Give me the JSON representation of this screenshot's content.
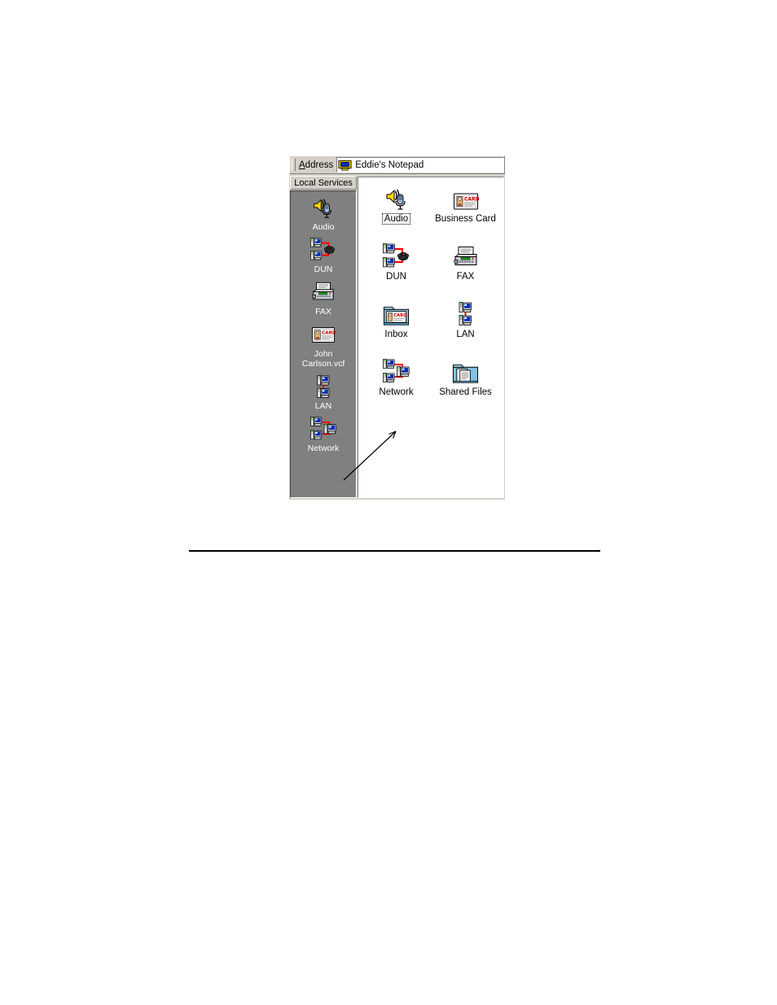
{
  "window": {
    "address_bar": {
      "label_prefix": "A",
      "label_rest": "ddress",
      "label_full": "Address",
      "icon": "notepad-device-icon",
      "value": "Eddie's Notepad",
      "placeholder": "Address"
    },
    "sidebar": {
      "header": "Local Services",
      "items": [
        {
          "label": "Audio",
          "icon": "audio-speaker-mic-icon"
        },
        {
          "label": "DUN",
          "icon": "dialup-networking-icon"
        },
        {
          "label": "FAX",
          "icon": "fax-machine-icon"
        },
        {
          "label": "John\nCarlson.vcf",
          "label_line1": "John",
          "label_line2": "Carlson.vcf",
          "icon": "business-card-icon"
        },
        {
          "label": "LAN",
          "icon": "lan-two-computers-icon"
        },
        {
          "label": "Network",
          "icon": "network-three-computers-icon"
        }
      ]
    },
    "content": {
      "items": [
        {
          "label": "Audio",
          "icon": "audio-speaker-mic-icon",
          "focused": true
        },
        {
          "label": "Business Card",
          "icon": "business-card-icon",
          "focused": false
        },
        {
          "label": "DUN",
          "icon": "dialup-networking-icon",
          "focused": false
        },
        {
          "label": "FAX",
          "icon": "fax-machine-icon",
          "focused": false
        },
        {
          "label": "Inbox",
          "icon": "inbox-folder-card-icon",
          "focused": false
        },
        {
          "label": "LAN",
          "icon": "lan-two-computers-icon",
          "focused": false
        },
        {
          "label": "Network",
          "icon": "network-three-computers-icon",
          "focused": false
        },
        {
          "label": "Shared Files",
          "icon": "shared-files-folder-icon",
          "focused": false
        }
      ]
    }
  },
  "colors": {
    "window_face": "#d4d0c8",
    "sidebar_bar": "#808080",
    "content_bg": "#ffffff",
    "shadow": "#808080",
    "highlight": "#ffffff",
    "text": "#000000",
    "sidebar_text": "#ffffff",
    "cable_red": "#ff0000",
    "screen_blue": "#0000c0",
    "folder_blue": "#5aaed6",
    "card_red": "#cc0000"
  },
  "annotation": {
    "type": "callout-arrow",
    "points_to": "Network",
    "from": "sidebar Network item"
  }
}
